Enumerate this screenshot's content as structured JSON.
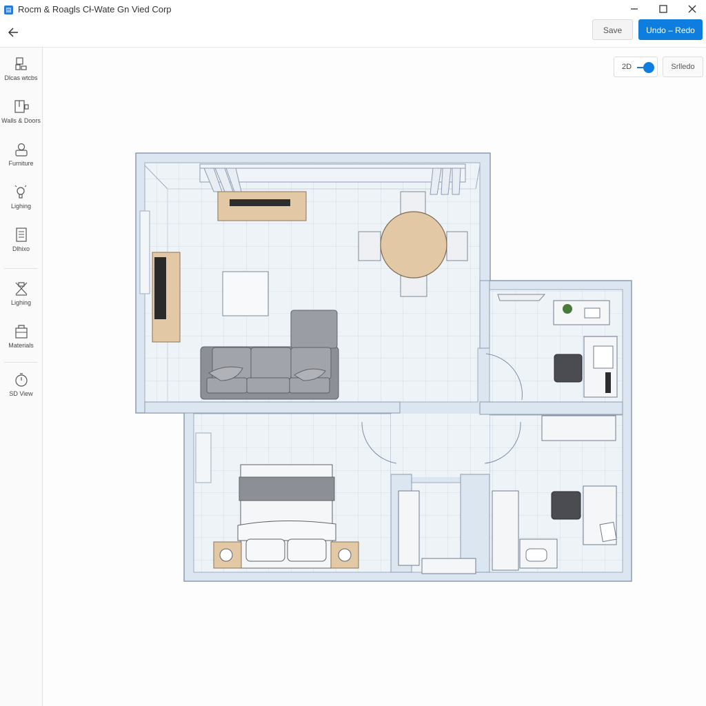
{
  "window": {
    "title": "Rocm & Roagls Cł-Wate Gn Vied Corp",
    "app_icon": "app-logo-icon",
    "controls": [
      "minimize-icon",
      "maximize-icon",
      "close-icon"
    ]
  },
  "toolbar": {
    "back_icon": "back-arrow-icon",
    "save_label": "Save",
    "undo_redo_label": "Undo – Redo"
  },
  "sidebar": {
    "items": [
      {
        "label": "Dlcas wtcbs",
        "icon": "rooms-icon"
      },
      {
        "label": "Walls & Doors",
        "icon": "walls-doors-icon"
      },
      {
        "label": "Furniture",
        "icon": "furniture-icon"
      },
      {
        "label": "Lighing",
        "icon": "lighting-bulb-icon"
      },
      {
        "label": "Dlhixo",
        "icon": "document-icon"
      },
      {
        "label": "Lighing",
        "icon": "lamp-icon"
      },
      {
        "label": "Materials",
        "icon": "materials-icon"
      },
      {
        "label": "SD View",
        "icon": "view-3d-icon"
      }
    ]
  },
  "view": {
    "toggle_label": "2D",
    "toggle_on": true,
    "secondary_label": "Srlledo"
  },
  "colors": {
    "accent": "#0d7ee0",
    "wall": "#dbe6f1",
    "wall_edge": "#8a9bb0",
    "floor": "#eef3f8",
    "wood": "#e2c8a4",
    "sofa": "#8d8f96"
  }
}
